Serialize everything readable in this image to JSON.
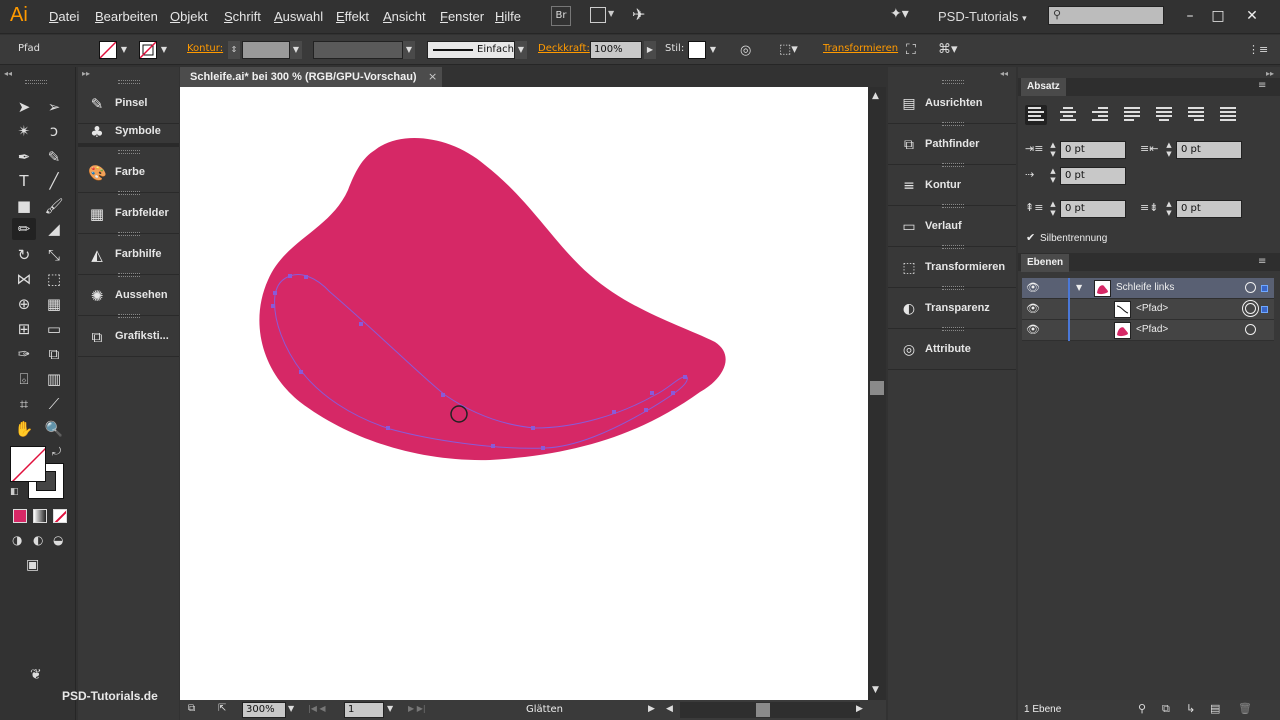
{
  "app": {
    "logo": "Ai",
    "workspace": "PSD-Tutorials",
    "workspace_arrow": "▾",
    "bridge_label": "Br"
  },
  "menu": [
    "Datei",
    "Bearbeiten",
    "Objekt",
    "Schrift",
    "Auswahl",
    "Effekt",
    "Ansicht",
    "Fenster",
    "Hilfe"
  ],
  "controlbar": {
    "selection_label": "Pfad",
    "stroke_label": "Kontur:",
    "stroke_style": "Einfach",
    "opacity_label": "Deckkraft:",
    "opacity_value": "100%",
    "style_label": "Stil:",
    "transform_link": "Transformieren"
  },
  "document": {
    "tab_title": "Schleife.ai* bei 300 % (RGB/GPU-Vorschau)",
    "close": "×"
  },
  "statusbar": {
    "zoom": "300%",
    "artboard": "1",
    "tool_status": "Glätten"
  },
  "panels_col1": [
    "Pinsel",
    "Symbole",
    "Farbe",
    "Farbfelder",
    "Farbhilfe",
    "Aussehen",
    "Grafiksti..."
  ],
  "panels_col2": [
    "Ausrichten",
    "Pathfinder",
    "Kontur",
    "Verlauf",
    "Transformieren",
    "Transparenz",
    "Attribute"
  ],
  "absatz": {
    "tab": "Absatz",
    "indent_left": "0 pt",
    "indent_right": "0 pt",
    "first_line": "0 pt",
    "space_before": "0 pt",
    "space_after": "0 pt",
    "hyphenation_label": "Silbentrennung",
    "hyphenation_checked": true
  },
  "ebenen": {
    "tab": "Ebenen",
    "layers": [
      {
        "name": "Schleife links",
        "selected": true
      },
      {
        "name": "<Pfad>",
        "selected": false
      },
      {
        "name": "<Pfad>",
        "selected": false
      }
    ],
    "footer": "1 Ebene"
  },
  "watermark": "PSD-Tutorials.de",
  "colors": {
    "shape_fill": "#d62866",
    "accent": "#ff9a00",
    "path_highlight": "#8a5ad8"
  }
}
